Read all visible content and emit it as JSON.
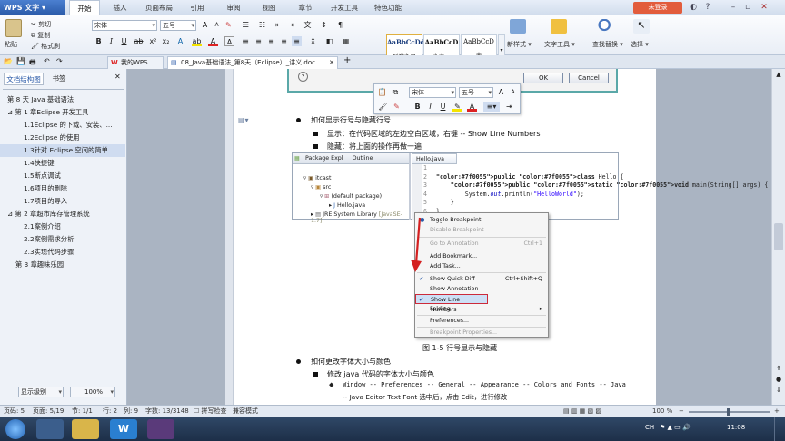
{
  "app": {
    "name": "WPS 文字",
    "login": "未登录"
  },
  "menu_tabs": [
    "开始",
    "插入",
    "页面布局",
    "引用",
    "审阅",
    "视图",
    "章节",
    "开发工具",
    "特色功能"
  ],
  "ribbon": {
    "paste": "粘贴",
    "cut": "剪切",
    "copy": "复制",
    "format_painter": "格式刷",
    "font": "宋体",
    "size": "五号",
    "styles": [
      {
        "sample": "AaBbCcDd",
        "name": "列举条目"
      },
      {
        "sample": "AaBbCcD",
        "name": "多字..."
      },
      {
        "sample": "AaBbCcD",
        "name": "表"
      }
    ],
    "new_style": "新样式",
    "text_tools": "文字工具",
    "find_replace": "查找替换",
    "select": "选择"
  },
  "doc_tabs": {
    "wps": "我的WPS",
    "doc": "08_Java基础语法_第8天（Eclipse）_讲义.doc"
  },
  "left_panel": {
    "tab_outline": "文档结构图",
    "tab_bookmark": "书签",
    "items": [
      "第 8 天 Java 基础语法",
      "第 1 章Eclipse 开发工具",
      "1.1Eclipse 的下载、安装、...",
      "1.2Eclipse 的使用",
      "1.3针对 Eclipse 空间的简单...",
      "1.4快捷键",
      "1.5断点调试",
      "1.6项目的删除",
      "1.7项目的导入",
      "第 2 章超市库存管理系统",
      "2.1案例介绍",
      "2.2案例需求分析",
      "2.3实现代码步骤",
      "第 3 章趣味乐园"
    ],
    "level_label": "显示级别",
    "zoom": "100%"
  },
  "dialog": {
    "help": "?",
    "ok": "OK",
    "cancel": "Cancel"
  },
  "float_toolbar": {
    "font": "宋体",
    "size": "五号"
  },
  "doc": {
    "b1": "如何显示行号与隐藏行号",
    "s1": "显示：在代码区域的左边空白区域，右键 -- Show Line Numbers",
    "s2": "隐藏：将上面的操作再做一遍",
    "caption": "图 1-5  行号显示与隐藏",
    "b2": "如何更改字体大小与颜色",
    "s3": "修改 java 代码的字体大小与颜色",
    "d1": "Window -- Preferences -- General -- Appearance -- Colors and Fonts -- Java",
    "d2": "-- Java Editor Text Font 选中后，点击 Edit，进行修改"
  },
  "eclipse": {
    "pkg_tab": "Package Expl",
    "outline_tab": "Outline",
    "editor_tab": "Hello.java",
    "tree": [
      "itcast",
      "src",
      "(default package)",
      "Hello.java",
      "JRE System Library",
      "[JavaSE-1.7]"
    ],
    "code": [
      {
        "n": "1",
        "t": ""
      },
      {
        "n": "2",
        "t": "public class Hello {"
      },
      {
        "n": "3",
        "t": "    public static void main(String[] args) {"
      },
      {
        "n": "4",
        "t": "        System.out.println(\"HelloWorld\");"
      },
      {
        "n": "5",
        "t": "    }"
      },
      {
        "n": "6",
        "t": "}"
      }
    ]
  },
  "context_menu": {
    "toggle": "Toggle Breakpoint",
    "disable": "Disable Breakpoint",
    "goto": "Go to Annotation",
    "goto_sc": "Ctrl+1",
    "bookmark": "Add Bookmark...",
    "task": "Add Task...",
    "quickdiff": "Show Quick Diff",
    "quickdiff_sc": "Ctrl+Shift+Q",
    "annotation": "Show Annotation",
    "linenumbers": "Show Line Numbers",
    "folding": "Folding",
    "prefs": "Preferences...",
    "bp_props": "Breakpoint Properties..."
  },
  "status": {
    "page": "页码: 5",
    "pages": "页面: 5/19",
    "section": "节: 1/1",
    "row": "行: 2",
    "col": "列: 9",
    "words": "字数: 13/3148",
    "spell": "拼写检查",
    "compat": "兼容模式",
    "zoom": "100 %"
  },
  "taskbar": {
    "lang": "CH",
    "time": "11:08"
  },
  "colors": {
    "accent": "#2a5aa8",
    "teal": "#5aa8a8",
    "highlight": "#cc2a3a",
    "arrow": "#d42020"
  }
}
